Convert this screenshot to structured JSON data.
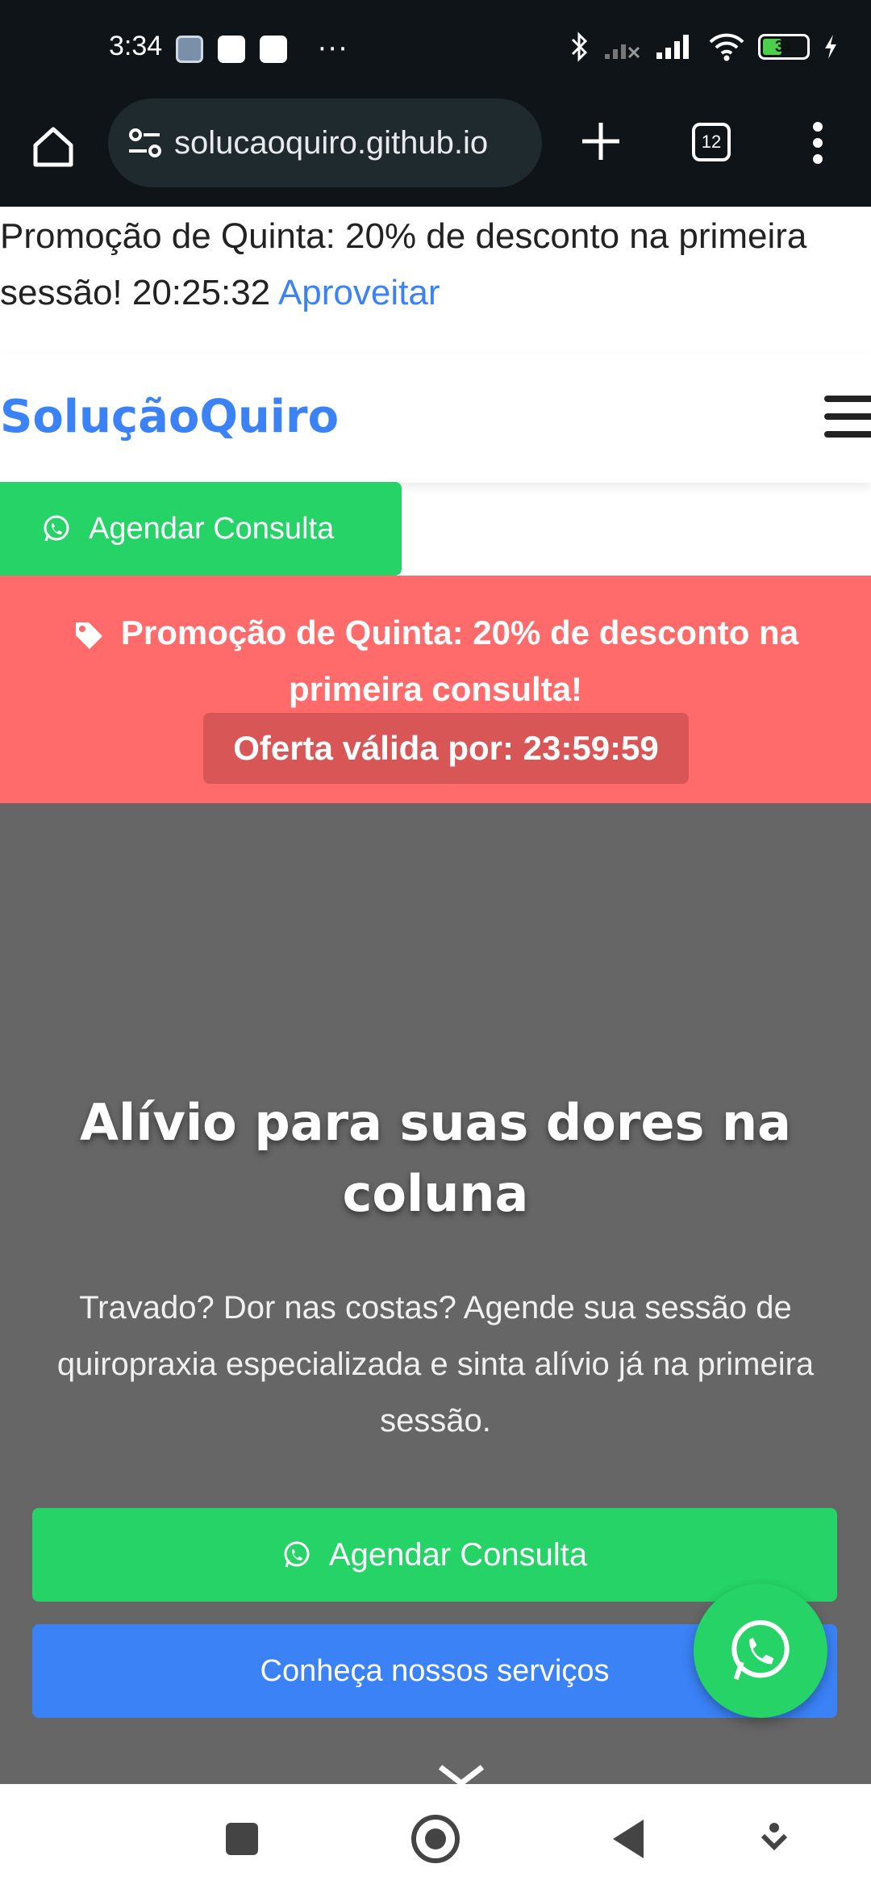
{
  "status_bar": {
    "time": "3:34",
    "battery": "31",
    "notif_more": "···"
  },
  "browser": {
    "url": "solucaoquiro.github.io",
    "tab_count": "12"
  },
  "promo_line": {
    "text": "Promoção de Quinta: 20% de desconto na primeira sessão! 20:25:32 ",
    "link": "Aproveitar"
  },
  "navbar": {
    "brand": "SoluçãoQuiro"
  },
  "cta_top": {
    "label": "Agendar Consulta"
  },
  "red_banner": {
    "text": "Promoção de Quinta: 20% de desconto na primeira consulta!",
    "offer": "Oferta válida por: 23:59:59"
  },
  "hero": {
    "title": "Alívio para suas dores na coluna",
    "subtitle": "Travado? Dor nas costas? Agende sua sessão de quiropraxia especializada e sinta alívio já na primeira sessão.",
    "primary_button": "Agendar Consulta",
    "secondary_button": "Conheça nossos serviços"
  },
  "colors": {
    "brand_blue": "#3b82f6",
    "whatsapp_green": "#25d366",
    "promo_red": "#ff6b6b",
    "hero_gray": "#666666"
  }
}
